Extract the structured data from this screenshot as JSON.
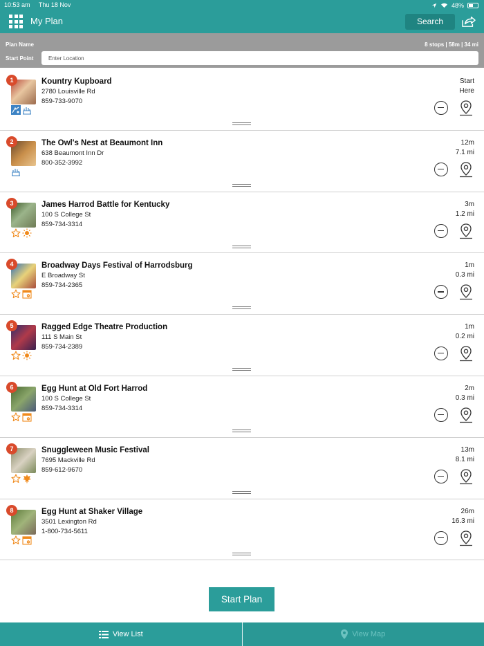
{
  "status_bar": {
    "time": "10:53 am",
    "date": "Thu 18 Nov",
    "battery": "48%"
  },
  "header": {
    "title": "My Plan",
    "search_label": "Search"
  },
  "plan": {
    "name_label": "Plan Name",
    "summary": "8 stops | 58m | 34 mi",
    "start_point_label": "Start Point",
    "start_point_placeholder": "Enter Location"
  },
  "stops": [
    {
      "number": "1",
      "name": "Kountry Kupboard",
      "address": "2780 Louisville Rd",
      "phone": "859-733-9070",
      "time": "Start",
      "distance": "Here",
      "categories": [
        "shopping-icon",
        "dining-icon"
      ]
    },
    {
      "number": "2",
      "name": "The Owl's Nest at Beaumont Inn",
      "address": "638 Beaumont Inn Dr",
      "phone": "800-352-3992",
      "time": "12m",
      "distance": "7.1 mi",
      "categories": [
        "dining-icon"
      ]
    },
    {
      "number": "3",
      "name": "James Harrod Battle for Kentucky",
      "address": "100 S College St",
      "phone": "859-734-3314",
      "time": "3m",
      "distance": "1.2 mi",
      "categories": [
        "star-icon",
        "sun-icon"
      ]
    },
    {
      "number": "4",
      "name": "Broadway Days Festival of Harrodsburg",
      "address": "E Broadway St",
      "phone": "859-734-2365",
      "time": "1m",
      "distance": "0.3 mi",
      "categories": [
        "star-icon",
        "calendar-icon"
      ]
    },
    {
      "number": "5",
      "name": "Ragged Edge Theatre Production",
      "address": "111 S Main St",
      "phone": "859-734-2389",
      "time": "1m",
      "distance": "0.2 mi",
      "categories": [
        "star-icon",
        "sun-icon"
      ]
    },
    {
      "number": "6",
      "name": "Egg Hunt at Old Fort Harrod",
      "address": "100 S College St",
      "phone": "859-734-3314",
      "time": "2m",
      "distance": "0.3 mi",
      "categories": [
        "star-icon",
        "calendar-icon"
      ]
    },
    {
      "number": "7",
      "name": "Snuggleween Music Festival",
      "address": "7695 Mackville Rd",
      "phone": "859-612-9670",
      "time": "13m",
      "distance": "8.1 mi",
      "categories": [
        "star-icon",
        "leaf-icon"
      ]
    },
    {
      "number": "8",
      "name": "Egg Hunt at Shaker Village",
      "address": "3501 Lexington Rd",
      "phone": "1-800-734-5611",
      "time": "26m",
      "distance": "16.3 mi",
      "categories": [
        "star-icon",
        "calendar-icon"
      ]
    }
  ],
  "actions": {
    "start_plan_label": "Start Plan"
  },
  "bottom_nav": {
    "list_label": "View List",
    "map_label": "View Map"
  },
  "colors": {
    "teal": "#2b9d9a",
    "badge": "#d94a2b",
    "category_blue": "#3c83c4",
    "category_orange": "#f08a1c",
    "plan_bar": "#9b9b9b"
  }
}
